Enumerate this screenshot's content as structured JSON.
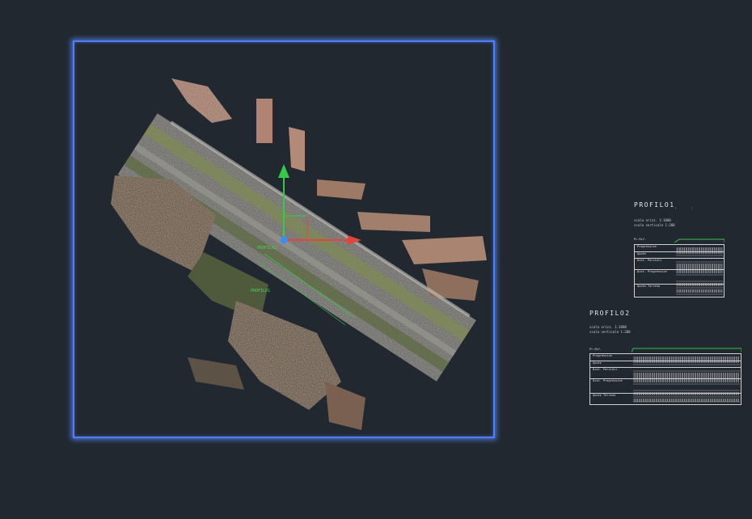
{
  "canvas": {
    "background": "#212830",
    "viewport_border_color": "#4f7dff",
    "ucs_labels": {
      "profile_label": "PROFILO2",
      "profile_label_2": "PROFILO1"
    },
    "axis_colors": {
      "y": "#35c94a",
      "x": "#e0463c",
      "origin": "#3d8cff"
    }
  },
  "profiles": [
    {
      "title": "PROFILO1",
      "scale_h": "scala orizz.  1:1000",
      "scale_v": "scala verticale  1:200",
      "rows": [
        "Pr.Rif.",
        "Progressive",
        "Quote",
        "Dist. Parziali",
        "Dist. Progressive",
        "Quote Terreno"
      ],
      "nums": {
        "start": "0",
        "end": "0"
      }
    },
    {
      "title": "PROFILO2",
      "scale_h": "scala orizz.  1:1000",
      "scale_v": "scala verticale  1:200",
      "rows": [
        "Pr.Rif.",
        "Progressive",
        "Quote",
        "Dist. Parziali",
        "Dist. Progressive",
        "Quote Terreno"
      ],
      "nums": {
        "start": "0",
        "end": "0"
      }
    }
  ]
}
